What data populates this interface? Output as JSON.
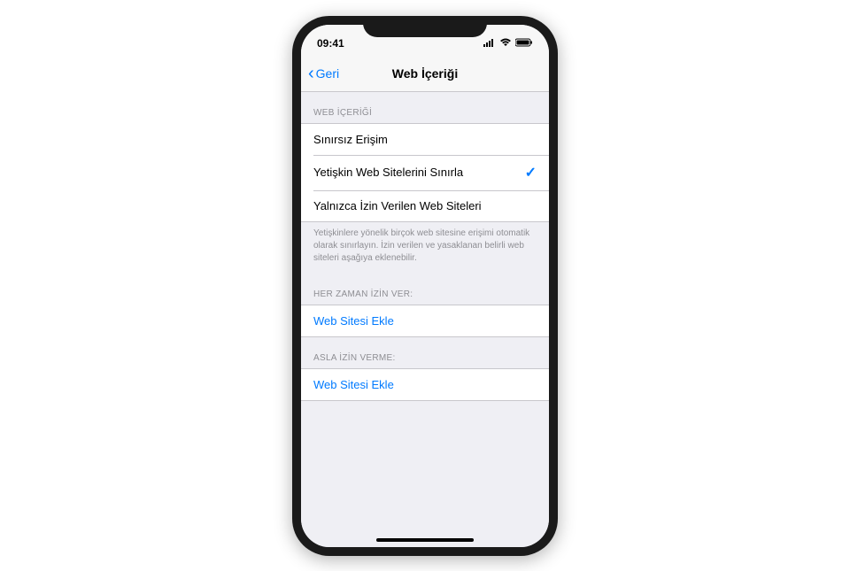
{
  "status_bar": {
    "time": "09:41"
  },
  "nav": {
    "back_label": "Geri",
    "title": "Web İçeriği"
  },
  "sections": {
    "web_content": {
      "header": "WEB İÇERİĞİ",
      "options": [
        {
          "label": "Sınırsız Erişim",
          "selected": false
        },
        {
          "label": "Yetişkin Web Sitelerini Sınırla",
          "selected": true
        },
        {
          "label": "Yalnızca İzin Verilen Web Siteleri",
          "selected": false
        }
      ],
      "footer": "Yetişkinlere yönelik birçok web sitesine erişimi otomatik olarak sınırlayın. İzin verilen ve yasaklanan belirli web siteleri aşağıya eklenebilir."
    },
    "always_allow": {
      "header": "HER ZAMAN İZİN VER:",
      "add_label": "Web Sitesi Ekle"
    },
    "never_allow": {
      "header": "ASLA İZİN VERME:",
      "add_label": "Web Sitesi Ekle"
    }
  }
}
